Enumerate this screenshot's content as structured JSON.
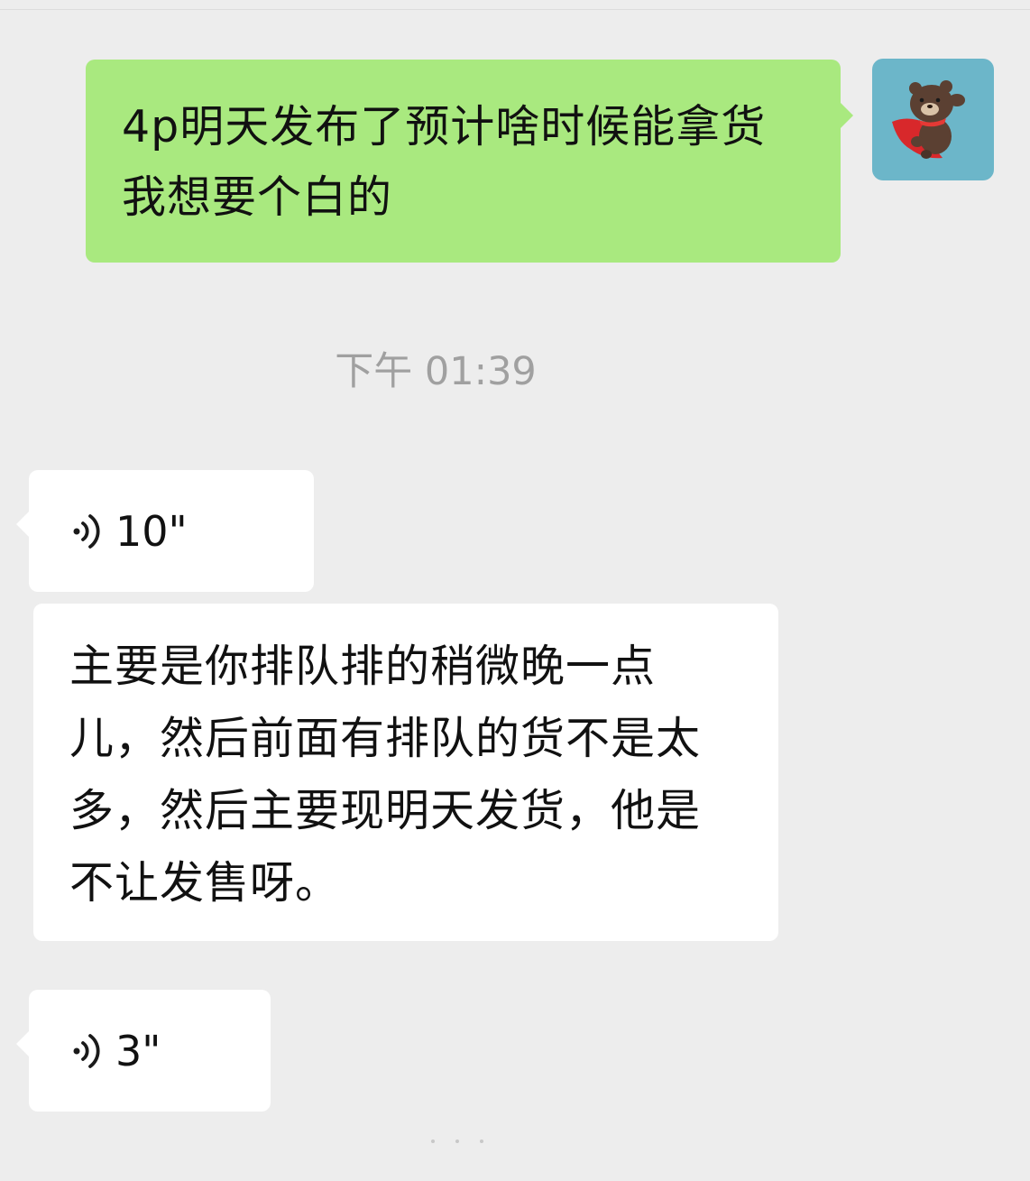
{
  "conversation": {
    "messages": [
      {
        "type": "text",
        "direction": "outgoing",
        "text": "4p明天发布了预计啥时候能拿货 我想要个白的"
      },
      {
        "type": "timestamp",
        "text": "下午 01:39"
      },
      {
        "type": "voice",
        "direction": "incoming",
        "duration": "10\""
      },
      {
        "type": "text",
        "direction": "incoming",
        "text": "主要是你排队排的稍微晚一点儿，然后前面有排队的货不是太多，然后主要现明天发货，他是不让发售呀。"
      },
      {
        "type": "voice",
        "direction": "incoming",
        "duration": "3\""
      }
    ],
    "self_avatar_icon": "brown-bear-cape-avatar"
  },
  "colors": {
    "background": "#ededed",
    "outgoing_bubble": "#a9e97f",
    "incoming_bubble": "#ffffff",
    "timestamp_text": "#a0a0a0",
    "avatar_bg": "#6cb6c9"
  }
}
